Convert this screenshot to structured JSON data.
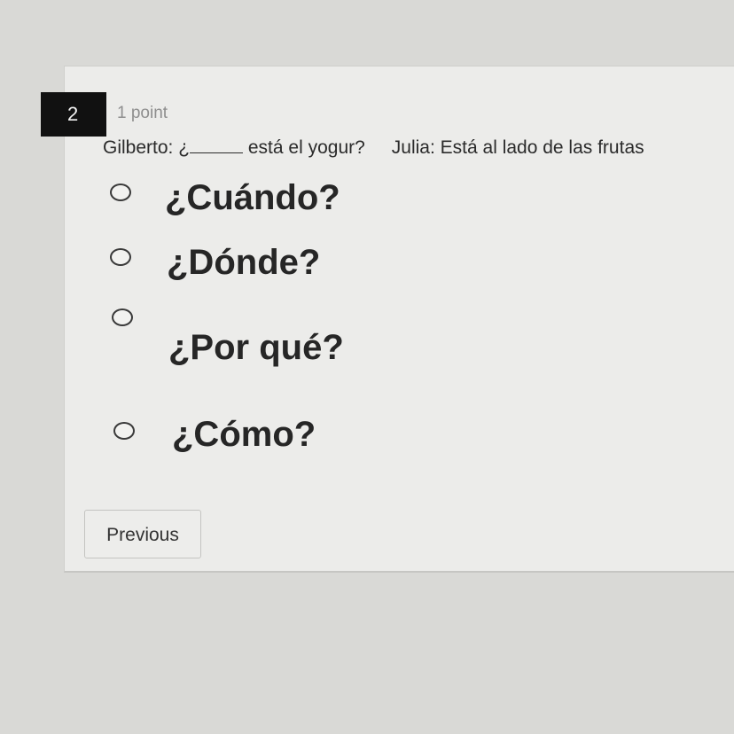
{
  "question": {
    "number": "2",
    "points": "1 point",
    "prompt_start": "Gilberto: ¿",
    "prompt_middle": "está el yogur?",
    "prompt_end": "Julia: Está al lado de las frutas"
  },
  "options": [
    {
      "label": "¿Cuándo?",
      "selected": false
    },
    {
      "label": "¿Dónde?",
      "selected": false
    },
    {
      "label": "¿Por qué?",
      "selected": false
    },
    {
      "label": "¿Cómo?",
      "selected": false
    }
  ],
  "nav": {
    "previous_label": "Previous"
  }
}
